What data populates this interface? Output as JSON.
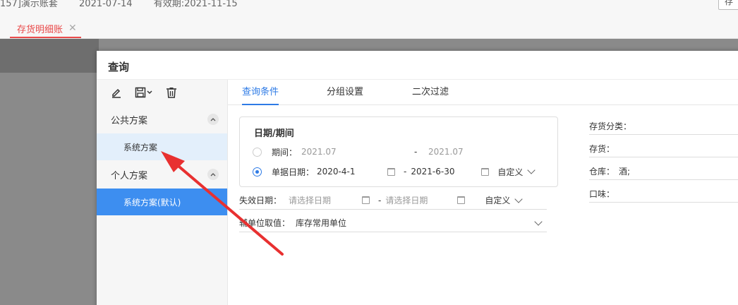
{
  "header": {
    "account": "157]演示账套",
    "date": "2021-07-14",
    "expiry": "有效期:2021-11-15",
    "cut_button": "存"
  },
  "tab": {
    "label": "存货明细账",
    "close": "✕"
  },
  "dialog": {
    "title": "查询",
    "left": {
      "public_group": "公共方案",
      "public_items": [
        "系统方案"
      ],
      "personal_group": "个人方案",
      "personal_items": [
        "系统方案(默认)"
      ]
    },
    "tabs": [
      "查询条件",
      "分组设置",
      "二次过滤"
    ],
    "date_section": {
      "title": "日期/期间",
      "period_label": "期间：",
      "period_from": "2021.07",
      "period_sep": "-",
      "period_to": "2021.07",
      "doc_date_label": "单据日期：",
      "doc_date_from": "2020-4-1",
      "doc_date_sep": "-",
      "doc_date_to": "2021-6-30",
      "custom": "自定义"
    },
    "expiry_date": {
      "label": "失效日期：",
      "from_placeholder": "请选择日期",
      "sep": "-",
      "to_placeholder": "请选择日期",
      "custom": "自定义"
    },
    "aux_unit": {
      "label": "辅单位取值：",
      "value": "库存常用单位"
    },
    "right_fields": [
      {
        "label": "存货分类：",
        "value": ""
      },
      {
        "label": "存货：",
        "value": ""
      },
      {
        "label": "仓库：",
        "value": "酒;"
      },
      {
        "label": "口味：",
        "value": ""
      }
    ]
  },
  "colors": {
    "accent": "#2e7be6",
    "tab_red": "#e94a4a",
    "selected_bg": "#3d8ef0",
    "hover_bg": "#e3effb"
  }
}
